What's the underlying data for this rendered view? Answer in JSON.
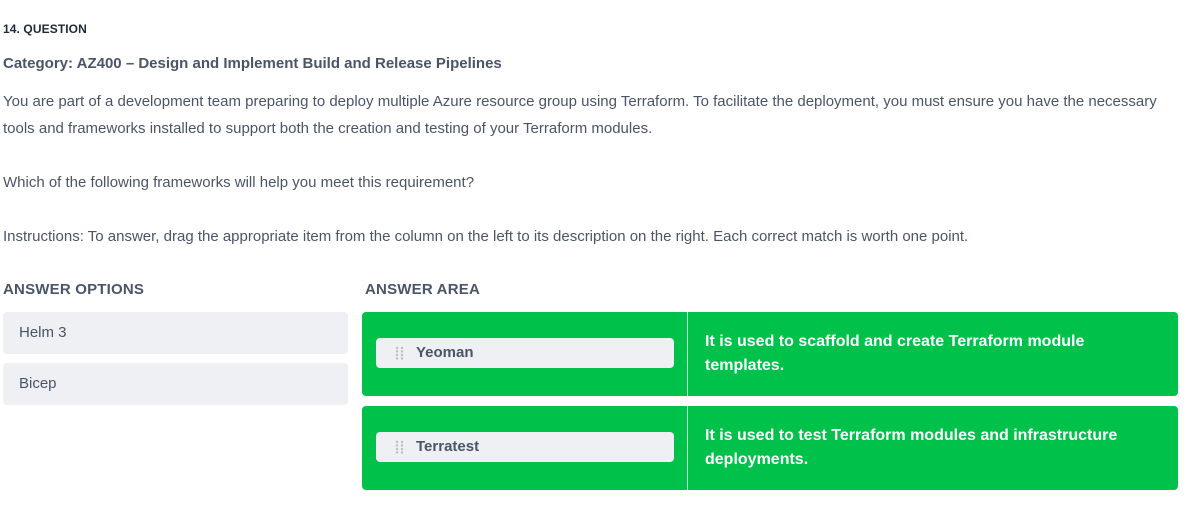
{
  "question": {
    "number_label": "14. QUESTION",
    "category": "Category: AZ400 – Design and Implement Build and Release Pipelines",
    "paragraphs": [
      "You are part of a development team preparing to deploy multiple Azure resource group using Terraform. To facilitate the deployment, you must ensure you have the necessary tools and frameworks installed to support both the creation and testing of your Terraform modules.",
      "Which of the following frameworks will help you meet this requirement?",
      "Instructions: To answer, drag the appropriate item from the column on the left to its description on the right. Each correct match is worth one point."
    ]
  },
  "answer_options": {
    "title": "ANSWER OPTIONS",
    "items": [
      {
        "label": "Helm 3"
      },
      {
        "label": "Bicep"
      }
    ]
  },
  "answer_area": {
    "title": "ANSWER AREA",
    "accent_color": "#00c24a",
    "rows": [
      {
        "item": "Yeoman",
        "description": "It is used to scaffold and create Terraform module templates.",
        "icon": "drag-handle-icon"
      },
      {
        "item": "Terratest",
        "description": "It is used to test Terraform modules and infrastructure deployments.",
        "icon": "drag-handle-icon"
      }
    ]
  }
}
